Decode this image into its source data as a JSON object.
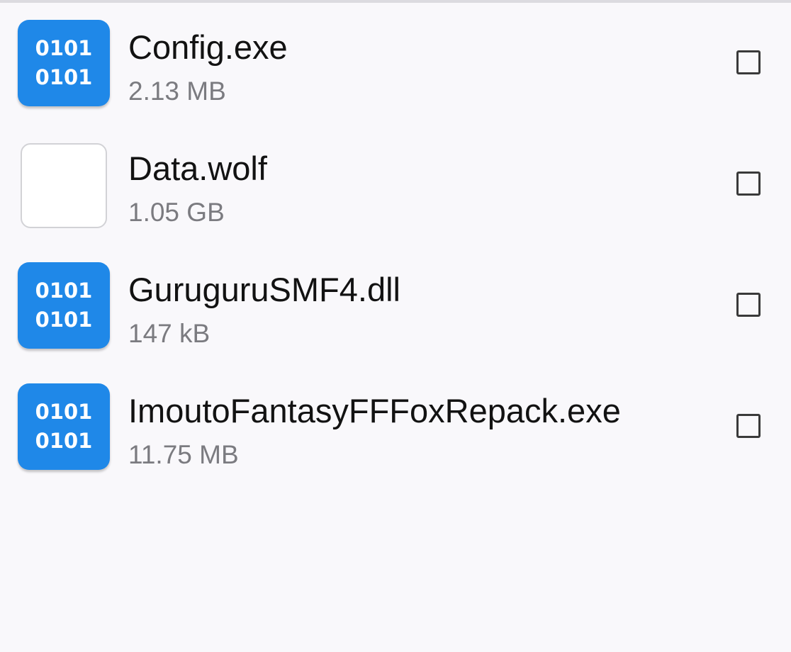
{
  "files": [
    {
      "icon": "binary-file-icon",
      "icon_text": [
        "0101",
        "0101"
      ],
      "name": "Config.exe",
      "size": "2.13 MB",
      "checked": false
    },
    {
      "icon": "blank-file-icon",
      "icon_text": [
        "",
        ""
      ],
      "name": "Data.wolf",
      "size": "1.05 GB",
      "checked": false
    },
    {
      "icon": "binary-file-icon",
      "icon_text": [
        "0101",
        "0101"
      ],
      "name": "GuruguruSMF4.dll",
      "size": "147 kB",
      "checked": false
    },
    {
      "icon": "binary-file-icon",
      "icon_text": [
        "0101",
        "0101"
      ],
      "name": "ImoutoFantasyFFFoxRepack.exe",
      "size": "11.75 MB",
      "checked": false
    }
  ],
  "colors": {
    "background": "#f9f8fb",
    "binary_icon": "#1f88e8",
    "file_name": "#121212",
    "file_size": "#7b7b80",
    "checkbox_border": "#3a3a3a"
  }
}
